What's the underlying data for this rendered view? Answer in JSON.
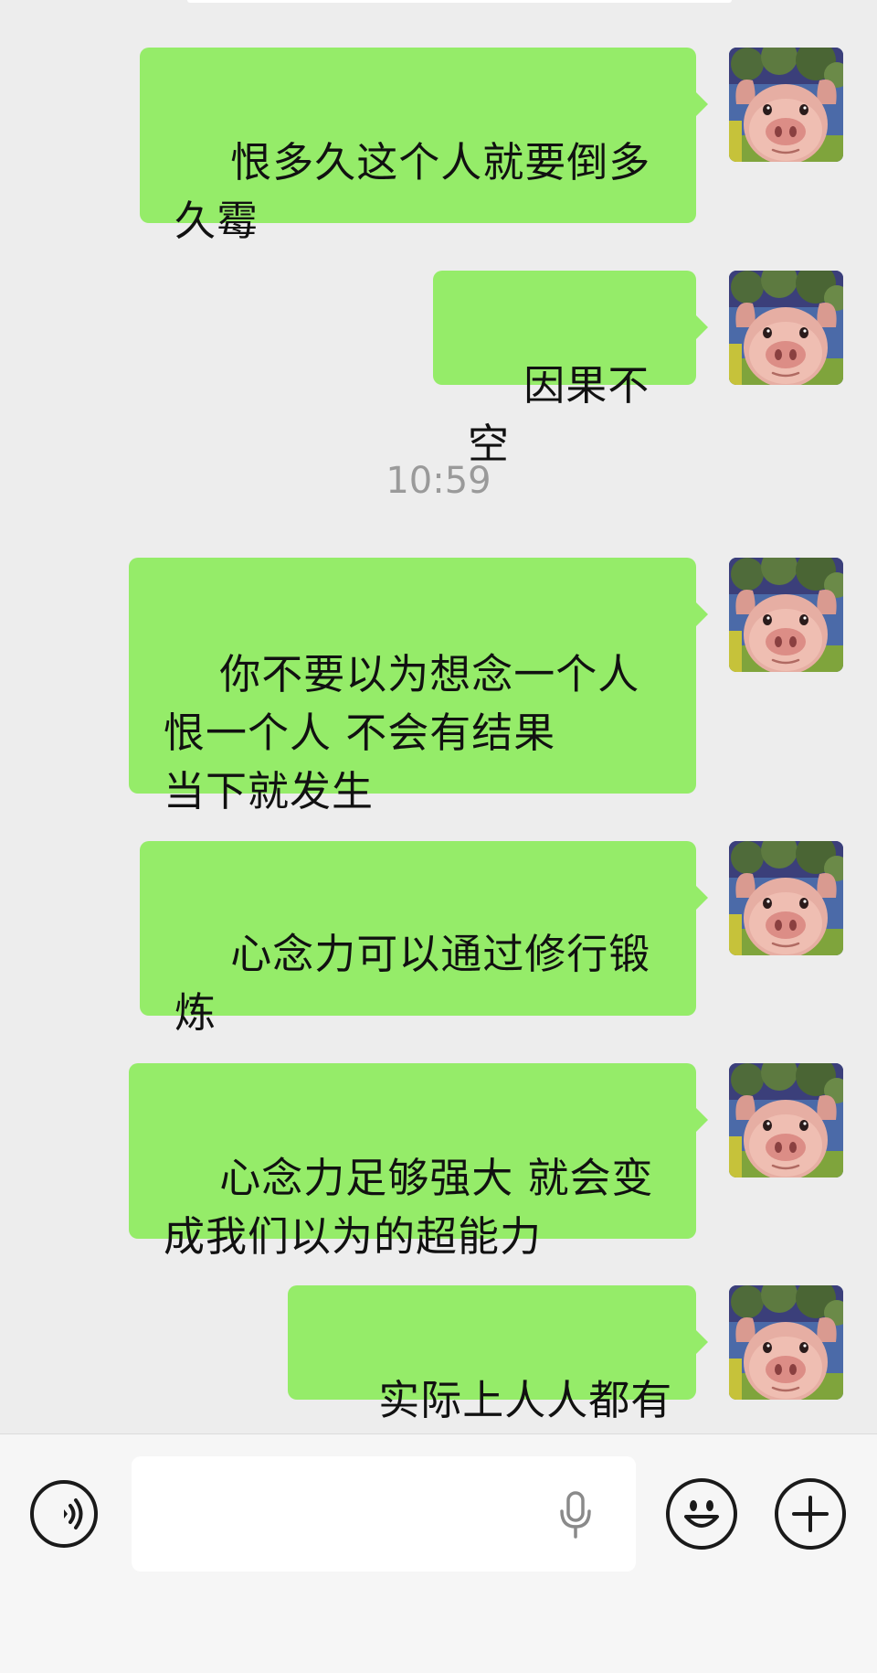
{
  "chat": {
    "timestamp": "10:59",
    "messages": [
      {
        "text": "恨多久这个人就要倒多\n久霉",
        "sender": "self"
      },
      {
        "text": "因果不空",
        "sender": "self"
      },
      {
        "text": "你不要以为想念一个人\n恨一个人 不会有结果\n当下就发生",
        "sender": "self"
      },
      {
        "text": "心念力可以通过修行锻\n炼",
        "sender": "self"
      },
      {
        "text": "心念力足够强大 就会变\n成我们以为的超能力",
        "sender": "self"
      },
      {
        "text": "实际上人人都有",
        "sender": "self"
      }
    ]
  },
  "avatar": {
    "icon": "pig-avatar-icon"
  },
  "input_bar": {
    "voice_icon": "voice-mode-icon",
    "mic_icon": "microphone-icon",
    "emoji_icon": "emoji-icon",
    "plus_icon": "plus-icon",
    "input_value": ""
  },
  "colors": {
    "bubble": "#95ec69",
    "background": "#ededed",
    "timestamp": "#9a9a9a"
  }
}
